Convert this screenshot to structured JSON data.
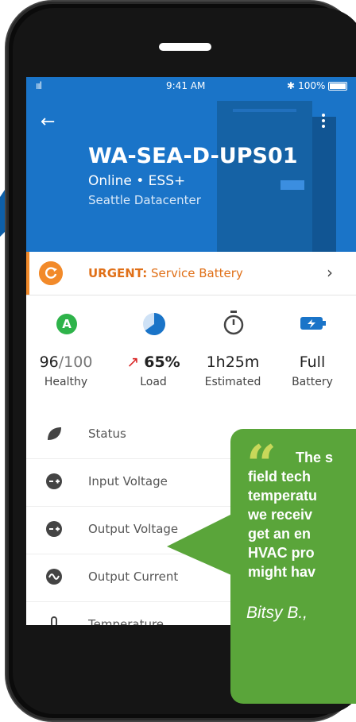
{
  "status_bar": {
    "signal": "ııl",
    "time": "9:41 AM",
    "battery": "100%"
  },
  "device": {
    "title": "WA-SEA-D-UPS01",
    "status": "Online • ESS+",
    "location": "Seattle Datacenter"
  },
  "alert": {
    "label_bold": "URGENT:",
    "label_rest": " Service Battery"
  },
  "stats": [
    {
      "icon": "health-grade-icon",
      "badge": "A",
      "value_main": "96",
      "value_sub": "/100",
      "label": "Healthy"
    },
    {
      "icon": "load-pie-icon",
      "value_main": "65%",
      "arrow": "↗",
      "label": "Load"
    },
    {
      "icon": "stopwatch-icon",
      "value_main": "1h25m",
      "label": "Estimated"
    },
    {
      "icon": "battery-charging-icon",
      "value_main": "Full",
      "label": "Battery"
    }
  ],
  "load_fraction": 0.65,
  "list": [
    {
      "icon": "leaf-icon",
      "label": "Status"
    },
    {
      "icon": "input-voltage-icon",
      "label": "Input Voltage"
    },
    {
      "icon": "output-voltage-icon",
      "label": "Output Voltage"
    },
    {
      "icon": "output-current-icon",
      "label": "Output Current"
    },
    {
      "icon": "thermometer-icon",
      "label": "Temperature"
    }
  ],
  "quote": {
    "lines": [
      "The s",
      "field tech",
      "temperatu",
      "we receiv",
      "get an en",
      "HVAC pro",
      "might hav"
    ],
    "author": "Bitsy B.,"
  },
  "colors": {
    "brand_blue": "#1a74c8",
    "alert_orange": "#f28a2a",
    "health_green": "#2eb34a",
    "quote_green": "#5aa53a"
  }
}
